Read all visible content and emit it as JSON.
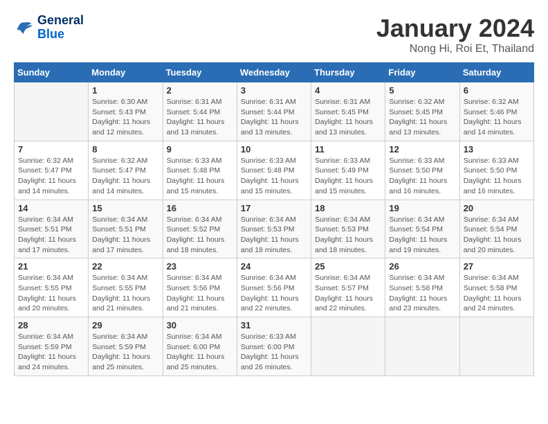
{
  "logo": {
    "line1": "General",
    "line2": "Blue"
  },
  "title": "January 2024",
  "subtitle": "Nong Hi, Roi Et, Thailand",
  "days_of_week": [
    "Sunday",
    "Monday",
    "Tuesday",
    "Wednesday",
    "Thursday",
    "Friday",
    "Saturday"
  ],
  "weeks": [
    [
      {
        "day": "",
        "info": ""
      },
      {
        "day": "1",
        "info": "Sunrise: 6:30 AM\nSunset: 5:43 PM\nDaylight: 11 hours\nand 12 minutes."
      },
      {
        "day": "2",
        "info": "Sunrise: 6:31 AM\nSunset: 5:44 PM\nDaylight: 11 hours\nand 13 minutes."
      },
      {
        "day": "3",
        "info": "Sunrise: 6:31 AM\nSunset: 5:44 PM\nDaylight: 11 hours\nand 13 minutes."
      },
      {
        "day": "4",
        "info": "Sunrise: 6:31 AM\nSunset: 5:45 PM\nDaylight: 11 hours\nand 13 minutes."
      },
      {
        "day": "5",
        "info": "Sunrise: 6:32 AM\nSunset: 5:45 PM\nDaylight: 11 hours\nand 13 minutes."
      },
      {
        "day": "6",
        "info": "Sunrise: 6:32 AM\nSunset: 5:46 PM\nDaylight: 11 hours\nand 14 minutes."
      }
    ],
    [
      {
        "day": "7",
        "info": "Sunrise: 6:32 AM\nSunset: 5:47 PM\nDaylight: 11 hours\nand 14 minutes."
      },
      {
        "day": "8",
        "info": "Sunrise: 6:32 AM\nSunset: 5:47 PM\nDaylight: 11 hours\nand 14 minutes."
      },
      {
        "day": "9",
        "info": "Sunrise: 6:33 AM\nSunset: 5:48 PM\nDaylight: 11 hours\nand 15 minutes."
      },
      {
        "day": "10",
        "info": "Sunrise: 6:33 AM\nSunset: 5:48 PM\nDaylight: 11 hours\nand 15 minutes."
      },
      {
        "day": "11",
        "info": "Sunrise: 6:33 AM\nSunset: 5:49 PM\nDaylight: 11 hours\nand 15 minutes."
      },
      {
        "day": "12",
        "info": "Sunrise: 6:33 AM\nSunset: 5:50 PM\nDaylight: 11 hours\nand 16 minutes."
      },
      {
        "day": "13",
        "info": "Sunrise: 6:33 AM\nSunset: 5:50 PM\nDaylight: 11 hours\nand 16 minutes."
      }
    ],
    [
      {
        "day": "14",
        "info": "Sunrise: 6:34 AM\nSunset: 5:51 PM\nDaylight: 11 hours\nand 17 minutes."
      },
      {
        "day": "15",
        "info": "Sunrise: 6:34 AM\nSunset: 5:51 PM\nDaylight: 11 hours\nand 17 minutes."
      },
      {
        "day": "16",
        "info": "Sunrise: 6:34 AM\nSunset: 5:52 PM\nDaylight: 11 hours\nand 18 minutes."
      },
      {
        "day": "17",
        "info": "Sunrise: 6:34 AM\nSunset: 5:53 PM\nDaylight: 11 hours\nand 18 minutes."
      },
      {
        "day": "18",
        "info": "Sunrise: 6:34 AM\nSunset: 5:53 PM\nDaylight: 11 hours\nand 18 minutes."
      },
      {
        "day": "19",
        "info": "Sunrise: 6:34 AM\nSunset: 5:54 PM\nDaylight: 11 hours\nand 19 minutes."
      },
      {
        "day": "20",
        "info": "Sunrise: 6:34 AM\nSunset: 5:54 PM\nDaylight: 11 hours\nand 20 minutes."
      }
    ],
    [
      {
        "day": "21",
        "info": "Sunrise: 6:34 AM\nSunset: 5:55 PM\nDaylight: 11 hours\nand 20 minutes."
      },
      {
        "day": "22",
        "info": "Sunrise: 6:34 AM\nSunset: 5:55 PM\nDaylight: 11 hours\nand 21 minutes."
      },
      {
        "day": "23",
        "info": "Sunrise: 6:34 AM\nSunset: 5:56 PM\nDaylight: 11 hours\nand 21 minutes."
      },
      {
        "day": "24",
        "info": "Sunrise: 6:34 AM\nSunset: 5:56 PM\nDaylight: 11 hours\nand 22 minutes."
      },
      {
        "day": "25",
        "info": "Sunrise: 6:34 AM\nSunset: 5:57 PM\nDaylight: 11 hours\nand 22 minutes."
      },
      {
        "day": "26",
        "info": "Sunrise: 6:34 AM\nSunset: 5:58 PM\nDaylight: 11 hours\nand 23 minutes."
      },
      {
        "day": "27",
        "info": "Sunrise: 6:34 AM\nSunset: 5:58 PM\nDaylight: 11 hours\nand 24 minutes."
      }
    ],
    [
      {
        "day": "28",
        "info": "Sunrise: 6:34 AM\nSunset: 5:59 PM\nDaylight: 11 hours\nand 24 minutes."
      },
      {
        "day": "29",
        "info": "Sunrise: 6:34 AM\nSunset: 5:59 PM\nDaylight: 11 hours\nand 25 minutes."
      },
      {
        "day": "30",
        "info": "Sunrise: 6:34 AM\nSunset: 6:00 PM\nDaylight: 11 hours\nand 25 minutes."
      },
      {
        "day": "31",
        "info": "Sunrise: 6:33 AM\nSunset: 6:00 PM\nDaylight: 11 hours\nand 26 minutes."
      },
      {
        "day": "",
        "info": ""
      },
      {
        "day": "",
        "info": ""
      },
      {
        "day": "",
        "info": ""
      }
    ]
  ]
}
